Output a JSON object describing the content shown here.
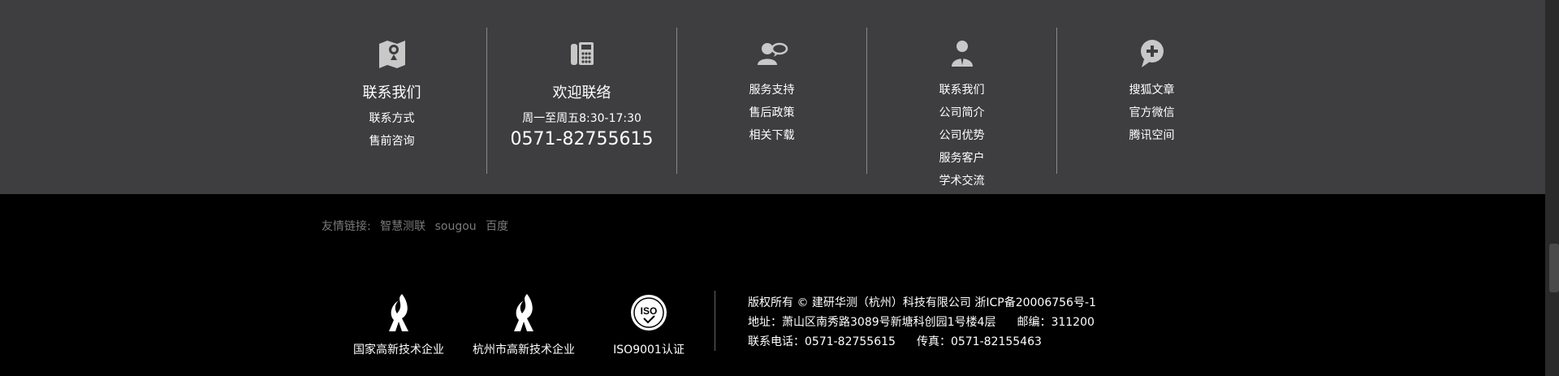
{
  "columns": [
    {
      "icon": "map-pin-icon",
      "title": "联系我们",
      "links": [
        "联系方式",
        "售前咨询"
      ]
    },
    {
      "icon": "phone-icon",
      "title": "欢迎联络",
      "hours": "周一至周五8:30-17:30",
      "phone": "0571-82755615"
    },
    {
      "icon": "support-chat-icon",
      "links": [
        "服务支持",
        "售后政策",
        "相关下载"
      ]
    },
    {
      "icon": "person-icon",
      "links": [
        "联系我们",
        "公司简介",
        "公司优势",
        "服务客户",
        "学术交流"
      ]
    },
    {
      "icon": "chat-plus-icon",
      "links": [
        "搜狐文章",
        "官方微信",
        "腾讯空间"
      ]
    }
  ],
  "friend_links": {
    "label": "友情链接:",
    "items": [
      "智慧测联",
      "sougou",
      "百度"
    ]
  },
  "badges": [
    {
      "icon": "torch-logo-icon",
      "caption": "国家高新技术企业"
    },
    {
      "icon": "torch-logo-icon",
      "caption": "杭州市高新技术企业"
    },
    {
      "icon": "iso-logo-icon",
      "caption": "ISO9001认证",
      "logo_text": "ISO"
    }
  ],
  "footer_info": {
    "copyright": "版权所有 © 建研华测（杭州）科技有限公司 浙ICP备20006756号-1",
    "address": "地址：萧山区南秀路3089号新塘科创园1号楼4层",
    "postcode": "邮编：311200",
    "tel": "联系电话：0571-82755615",
    "fax": "传真：0571-82155463"
  },
  "colors": {
    "top_bg": "#3e3e40",
    "bottom_bg": "#000000",
    "friend_text": "#7a7a7a",
    "icon_fill": "#c8c8c8"
  }
}
